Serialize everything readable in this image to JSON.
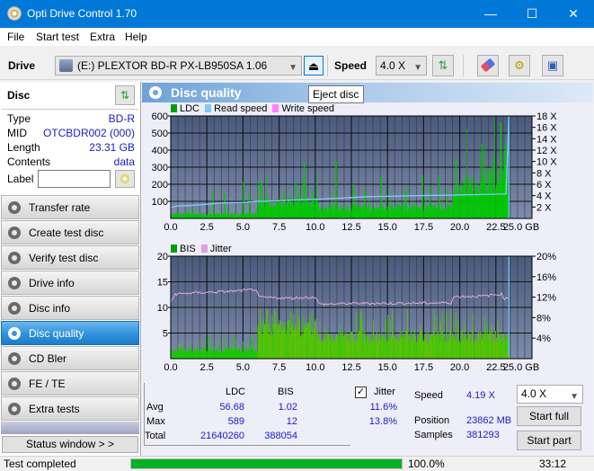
{
  "window": {
    "title": "Opti Drive Control 1.70",
    "minimize": "—",
    "maximize": "☐",
    "close": "✕"
  },
  "menu": [
    "File",
    "Start test",
    "Extra",
    "Help"
  ],
  "toolbar": {
    "drive_label": "Drive",
    "drive_value": "(E:)  PLEXTOR BD-R  PX-LB950SA 1.06",
    "eject_icon": "eject-icon",
    "speed_label": "Speed",
    "speed_value": "4.0 X",
    "tooltip": "Eject disc"
  },
  "disc": {
    "header": "Disc",
    "rows": [
      {
        "label": "Type",
        "value": "BD-R"
      },
      {
        "label": "MID",
        "value": "OTCBDR002 (000)"
      },
      {
        "label": "Length",
        "value": "23.31 GB"
      },
      {
        "label": "Contents",
        "value": "data"
      }
    ],
    "label_field_label": "Label",
    "label_value": ""
  },
  "nav": [
    {
      "label": "Transfer rate",
      "active": false
    },
    {
      "label": "Create test disc",
      "active": false
    },
    {
      "label": "Verify test disc",
      "active": false
    },
    {
      "label": "Drive info",
      "active": false
    },
    {
      "label": "Disc info",
      "active": false
    },
    {
      "label": "Disc quality",
      "active": true
    },
    {
      "label": "CD Bler",
      "active": false
    },
    {
      "label": "FE / TE",
      "active": false
    },
    {
      "label": "Extra tests",
      "active": false
    }
  ],
  "status_window_label": "Status window > >",
  "panel_title": "Disc quality",
  "chart_data": [
    {
      "type": "bar",
      "title": "LDC / Read speed",
      "legend": [
        "LDC",
        "Read speed",
        "Write speed"
      ],
      "legend_colors": [
        "#00a000",
        "#80c8ff",
        "#ff80ff"
      ],
      "x_ticks": [
        "0.0",
        "2.5",
        "5.0",
        "7.5",
        "10.0",
        "12.5",
        "15.0",
        "17.5",
        "20.0",
        "22.5",
        "25.0 GB"
      ],
      "xlim": [
        0,
        25
      ],
      "y_left_ticks": [
        "100",
        "200",
        "300",
        "400",
        "500",
        "600"
      ],
      "ylim_left": [
        0,
        600
      ],
      "y_right_ticks": [
        "2 X",
        "4 X",
        "6 X",
        "8 X",
        "10 X",
        "12 X",
        "14 X",
        "16 X",
        "18 X"
      ],
      "ylim_right": [
        0,
        18
      ],
      "ldc_segments": [
        {
          "x0": 0.0,
          "x1": 6.0,
          "base": 30,
          "peaks": [
            [
              2.9,
              165
            ],
            [
              3.7,
              150
            ],
            [
              5.0,
              215
            ],
            [
              5.4,
              145
            ],
            [
              1.2,
              55
            ]
          ]
        },
        {
          "x0": 6.0,
          "x1": 10.2,
          "base": 115,
          "peaks": [
            [
              6.2,
              210
            ],
            [
              7.8,
              165
            ],
            [
              8.6,
              215
            ],
            [
              9.2,
              330
            ],
            [
              9.8,
              175
            ]
          ]
        },
        {
          "x0": 10.2,
          "x1": 19.5,
          "base": 75,
          "peaks": [
            [
              11.4,
              350
            ],
            [
              12.6,
              200
            ],
            [
              13.4,
              170
            ],
            [
              14.5,
              240
            ],
            [
              16.2,
              165
            ],
            [
              17.4,
              255
            ],
            [
              17.9,
              190
            ],
            [
              18.5,
              250
            ],
            [
              19.1,
              170
            ]
          ]
        },
        {
          "x0": 19.5,
          "x1": 23.4,
          "base": 190,
          "peaks": [
            [
              19.7,
              350
            ],
            [
              20.4,
              260
            ],
            [
              21.5,
              440
            ],
            [
              22.3,
              360
            ],
            [
              22.8,
              560
            ],
            [
              23.1,
              400
            ]
          ]
        }
      ],
      "read_speed": [
        [
          0,
          2.0
        ],
        [
          0.6,
          2.2
        ],
        [
          1.5,
          2.3
        ],
        [
          2.5,
          2.5
        ],
        [
          3.5,
          2.7
        ],
        [
          5.0,
          2.8
        ],
        [
          6.0,
          3.0
        ],
        [
          7.5,
          3.1
        ],
        [
          9.0,
          3.3
        ],
        [
          10.3,
          3.4
        ],
        [
          12.0,
          3.6
        ],
        [
          13.5,
          3.8
        ],
        [
          15.2,
          3.9
        ],
        [
          17.0,
          4.0
        ],
        [
          19.5,
          4.1
        ],
        [
          21.5,
          4.2
        ],
        [
          23.2,
          4.3
        ],
        [
          23.4,
          18
        ]
      ]
    },
    {
      "type": "bar",
      "title": "BIS / Jitter",
      "legend": [
        "BIS",
        "Jitter"
      ],
      "legend_colors": [
        "#00a000",
        "#e0a0e0"
      ],
      "x_ticks": [
        "0.0",
        "2.5",
        "5.0",
        "7.5",
        "10.0",
        "12.5",
        "15.0",
        "17.5",
        "20.0",
        "22.5",
        "25.0 GB"
      ],
      "xlim": [
        0,
        25
      ],
      "y_left_ticks": [
        "5",
        "10",
        "15",
        "20"
      ],
      "ylim_left": [
        0,
        20
      ],
      "y_right_ticks": [
        "4%",
        "8%",
        "12%",
        "16%",
        "20%"
      ],
      "ylim_right": [
        0,
        20
      ],
      "bis_segments": [
        {
          "x0": 0.0,
          "x1": 6.0,
          "base": 2,
          "max": 5
        },
        {
          "x0": 6.0,
          "x1": 10.2,
          "base": 7,
          "max": 10
        },
        {
          "x0": 10.2,
          "x1": 23.4,
          "base": 5,
          "max": 10
        }
      ],
      "jitter": [
        [
          0,
          11
        ],
        [
          0.3,
          12.6
        ],
        [
          1.5,
          12.8
        ],
        [
          3,
          13.0
        ],
        [
          4.5,
          13.2
        ],
        [
          5.9,
          13.5
        ],
        [
          6.1,
          12.0
        ],
        [
          8,
          11.8
        ],
        [
          10.0,
          12.0
        ],
        [
          10.3,
          10.6
        ],
        [
          13,
          10.8
        ],
        [
          16,
          10.8
        ],
        [
          19.4,
          10.9
        ],
        [
          19.6,
          12.1
        ],
        [
          21.5,
          12.2
        ],
        [
          22.9,
          12.6
        ],
        [
          23.1,
          11.7
        ],
        [
          23.4,
          11.8
        ]
      ]
    }
  ],
  "stats": {
    "col_headers": [
      "LDC",
      "BIS"
    ],
    "rows": [
      {
        "label": "Avg",
        "ldc": "56.68",
        "bis": "1.02",
        "jitter": "11.6%"
      },
      {
        "label": "Max",
        "ldc": "589",
        "bis": "12",
        "jitter": "13.8%"
      },
      {
        "label": "Total",
        "ldc": "21640260",
        "bis": "388054",
        "jitter": ""
      }
    ],
    "jitter_label": "Jitter",
    "jitter_checked": true,
    "speed_label": "Speed",
    "speed_value": "4.19 X",
    "position_label": "Position",
    "position_value": "23862 MB",
    "samples_label": "Samples",
    "samples_value": "381293",
    "speed_select": "4.0 X",
    "start_full": "Start full",
    "start_part": "Start part"
  },
  "statusbar": {
    "text": "Test completed",
    "progress_percent": 100.0,
    "progress_label": "100.0%",
    "time": "33:12"
  }
}
